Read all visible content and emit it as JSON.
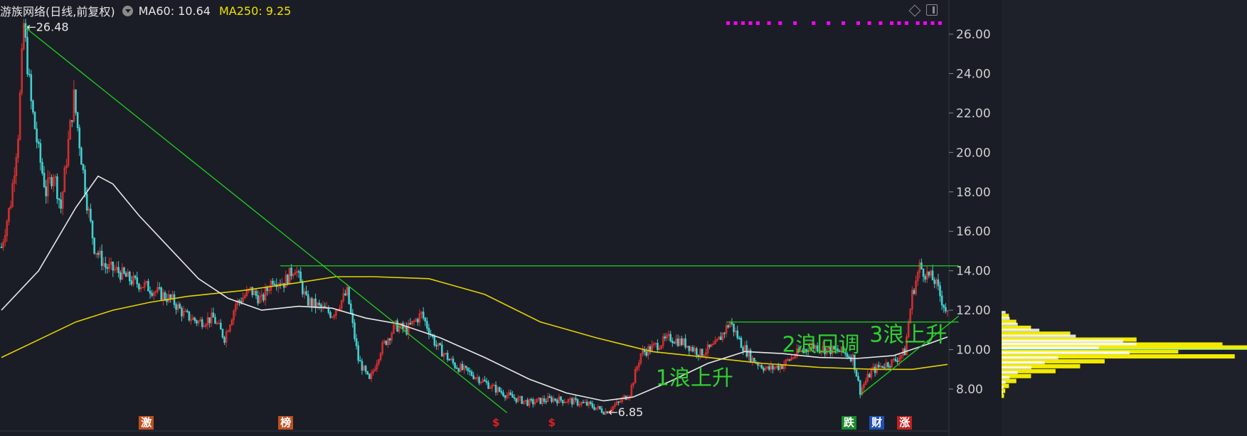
{
  "header": {
    "title": "游族网络(日线,前复权)",
    "ma60_label": "MA60: 10.64",
    "ma250_label": "MA250: 9.25"
  },
  "colors": {
    "background": "#1a1d25",
    "up_candle": "#e03030",
    "down_candle": "#40d0d0",
    "ma60": "#e8e8e8",
    "ma250": "#e6d000",
    "trendline": "#20d020",
    "annotation": "#30d030",
    "volume_profile": "#f2ea00",
    "signal_dots": "#ff00ff"
  },
  "icons": [
    "dropdown-circle-icon",
    "diamond-icon",
    "panel-toggle-icon"
  ],
  "chart_data": {
    "type": "candlestick",
    "ylim": [
      6.5,
      27.2
    ],
    "yticks": [
      "26.00",
      "24.00",
      "22.00",
      "20.00",
      "18.00",
      "16.00",
      "14.00",
      "12.00",
      "10.00",
      "8.00"
    ],
    "grid": false,
    "price_path": [
      {
        "day": 0,
        "close": 15.2
      },
      {
        "day": 5,
        "close": 17.5
      },
      {
        "day": 9,
        "close": 21.0
      },
      {
        "day": 12,
        "close": 26.48
      },
      {
        "day": 16,
        "close": 22.5
      },
      {
        "day": 20,
        "close": 20.0
      },
      {
        "day": 24,
        "close": 18.0
      },
      {
        "day": 28,
        "close": 19.0
      },
      {
        "day": 32,
        "close": 17.2
      },
      {
        "day": 36,
        "close": 20.5
      },
      {
        "day": 39,
        "close": 22.8
      },
      {
        "day": 42,
        "close": 20.5
      },
      {
        "day": 46,
        "close": 17.5
      },
      {
        "day": 50,
        "close": 15.2
      },
      {
        "day": 56,
        "close": 14.2
      },
      {
        "day": 62,
        "close": 14.0
      },
      {
        "day": 70,
        "close": 13.5
      },
      {
        "day": 78,
        "close": 13.2
      },
      {
        "day": 86,
        "close": 12.8
      },
      {
        "day": 92,
        "close": 12.5
      },
      {
        "day": 98,
        "close": 11.8
      },
      {
        "day": 106,
        "close": 11.4
      },
      {
        "day": 114,
        "close": 11.6
      },
      {
        "day": 120,
        "close": 10.6
      },
      {
        "day": 126,
        "close": 12.3
      },
      {
        "day": 134,
        "close": 13.0
      },
      {
        "day": 140,
        "close": 12.5
      },
      {
        "day": 146,
        "close": 13.6
      },
      {
        "day": 152,
        "close": 13.4
      },
      {
        "day": 158,
        "close": 14.2
      },
      {
        "day": 164,
        "close": 12.5
      },
      {
        "day": 170,
        "close": 12.2
      },
      {
        "day": 178,
        "close": 11.8
      },
      {
        "day": 186,
        "close": 12.9
      },
      {
        "day": 192,
        "close": 9.5
      },
      {
        "day": 198,
        "close": 8.4
      },
      {
        "day": 204,
        "close": 10.0
      },
      {
        "day": 212,
        "close": 11.2
      },
      {
        "day": 218,
        "close": 11.0
      },
      {
        "day": 226,
        "close": 11.8
      },
      {
        "day": 234,
        "close": 10.2
      },
      {
        "day": 244,
        "close": 9.2
      },
      {
        "day": 254,
        "close": 8.7
      },
      {
        "day": 264,
        "close": 8.1
      },
      {
        "day": 274,
        "close": 7.6
      },
      {
        "day": 284,
        "close": 7.3
      },
      {
        "day": 296,
        "close": 7.5
      },
      {
        "day": 306,
        "close": 7.4
      },
      {
        "day": 316,
        "close": 7.2
      },
      {
        "day": 325,
        "close": 6.85
      },
      {
        "day": 332,
        "close": 7.3
      },
      {
        "day": 338,
        "close": 7.8
      },
      {
        "day": 344,
        "close": 9.8
      },
      {
        "day": 352,
        "close": 10.2
      },
      {
        "day": 360,
        "close": 10.6
      },
      {
        "day": 368,
        "close": 10.3
      },
      {
        "day": 376,
        "close": 9.8
      },
      {
        "day": 384,
        "close": 10.2
      },
      {
        "day": 392,
        "close": 11.4
      },
      {
        "day": 398,
        "close": 10.3
      },
      {
        "day": 404,
        "close": 9.5
      },
      {
        "day": 412,
        "close": 9.0
      },
      {
        "day": 420,
        "close": 9.2
      },
      {
        "day": 428,
        "close": 9.8
      },
      {
        "day": 436,
        "close": 10.2
      },
      {
        "day": 444,
        "close": 10.0
      },
      {
        "day": 452,
        "close": 9.9
      },
      {
        "day": 458,
        "close": 9.6
      },
      {
        "day": 462,
        "close": 7.9
      },
      {
        "day": 468,
        "close": 8.9
      },
      {
        "day": 474,
        "close": 9.2
      },
      {
        "day": 480,
        "close": 9.4
      },
      {
        "day": 486,
        "close": 9.9
      },
      {
        "day": 490,
        "close": 12.8
      },
      {
        "day": 494,
        "close": 14.2
      },
      {
        "day": 498,
        "close": 13.8
      },
      {
        "day": 502,
        "close": 13.5
      },
      {
        "day": 506,
        "close": 12.5
      },
      {
        "day": 509,
        "close": 11.8
      }
    ],
    "ma60": [
      {
        "day": 0,
        "value": 12.0
      },
      {
        "day": 20,
        "value": 14.0
      },
      {
        "day": 40,
        "value": 17.2
      },
      {
        "day": 52,
        "value": 18.8
      },
      {
        "day": 60,
        "value": 18.4
      },
      {
        "day": 74,
        "value": 16.8
      },
      {
        "day": 90,
        "value": 15.2
      },
      {
        "day": 106,
        "value": 13.6
      },
      {
        "day": 122,
        "value": 12.6
      },
      {
        "day": 140,
        "value": 12.0
      },
      {
        "day": 160,
        "value": 12.2
      },
      {
        "day": 178,
        "value": 12.1
      },
      {
        "day": 196,
        "value": 11.6
      },
      {
        "day": 214,
        "value": 11.3
      },
      {
        "day": 236,
        "value": 10.6
      },
      {
        "day": 260,
        "value": 9.6
      },
      {
        "day": 284,
        "value": 8.5
      },
      {
        "day": 304,
        "value": 7.8
      },
      {
        "day": 324,
        "value": 7.4
      },
      {
        "day": 340,
        "value": 7.6
      },
      {
        "day": 360,
        "value": 8.4
      },
      {
        "day": 380,
        "value": 9.3
      },
      {
        "day": 400,
        "value": 9.9
      },
      {
        "day": 420,
        "value": 9.8
      },
      {
        "day": 440,
        "value": 9.6
      },
      {
        "day": 460,
        "value": 9.55
      },
      {
        "day": 480,
        "value": 9.7
      },
      {
        "day": 496,
        "value": 10.2
      },
      {
        "day": 509,
        "value": 10.64
      }
    ],
    "ma250": [
      {
        "day": 0,
        "value": 9.6
      },
      {
        "day": 20,
        "value": 10.5
      },
      {
        "day": 40,
        "value": 11.4
      },
      {
        "day": 60,
        "value": 12.0
      },
      {
        "day": 80,
        "value": 12.4
      },
      {
        "day": 100,
        "value": 12.7
      },
      {
        "day": 130,
        "value": 13.0
      },
      {
        "day": 160,
        "value": 13.4
      },
      {
        "day": 180,
        "value": 13.7
      },
      {
        "day": 200,
        "value": 13.7
      },
      {
        "day": 230,
        "value": 13.6
      },
      {
        "day": 260,
        "value": 12.8
      },
      {
        "day": 290,
        "value": 11.4
      },
      {
        "day": 320,
        "value": 10.6
      },
      {
        "day": 350,
        "value": 9.9
      },
      {
        "day": 380,
        "value": 9.6
      },
      {
        "day": 410,
        "value": 9.3
      },
      {
        "day": 440,
        "value": 9.1
      },
      {
        "day": 470,
        "value": 9.0
      },
      {
        "day": 490,
        "value": 9.0
      },
      {
        "day": 509,
        "value": 9.25
      }
    ],
    "trendlines": [
      {
        "from": {
          "day": 12,
          "price": 26.4
        },
        "to": {
          "day": 272,
          "price": 6.8
        }
      },
      {
        "from": {
          "day": 150,
          "price": 14.25
        },
        "to": {
          "day": 515,
          "price": 14.25
        }
      },
      {
        "from": {
          "day": 390,
          "price": 11.4
        },
        "to": {
          "day": 515,
          "price": 11.4
        }
      },
      {
        "from": {
          "day": 462,
          "price": 7.7
        },
        "to": {
          "day": 515,
          "price": 11.7
        }
      }
    ],
    "price_labels": [
      {
        "text": "26.48",
        "day": 12,
        "price": 26.48
      },
      {
        "text": "6.85",
        "day": 325,
        "price": 6.85
      }
    ],
    "annotations": [
      {
        "text": "1浪上升",
        "day": 352,
        "price": 8.2
      },
      {
        "text": "2浪回调",
        "day": 420,
        "price": 9.9
      },
      {
        "text": "3浪上升",
        "day": 467,
        "price": 10.4
      }
    ],
    "markers": [
      {
        "text": "激",
        "day": 77,
        "color": "#c0501f"
      },
      {
        "text": "榜",
        "day": 152,
        "color": "#c0501f"
      },
      {
        "text": "$",
        "day": 266,
        "color": "#e02020"
      },
      {
        "text": "$",
        "day": 296,
        "color": "#e02020"
      },
      {
        "text": "跌",
        "day": 455,
        "color": "#1a8a2a"
      },
      {
        "text": "财",
        "day": 470,
        "color": "#2050b0"
      },
      {
        "text": "涨",
        "day": 485,
        "color": "#c02020"
      }
    ],
    "volume_profile": [
      {
        "price": 11.6,
        "width": 0.03
      },
      {
        "price": 11.3,
        "width": 0.06
      },
      {
        "price": 11.0,
        "width": 0.12
      },
      {
        "price": 10.7,
        "width": 0.28
      },
      {
        "price": 10.4,
        "width": 0.55
      },
      {
        "price": 10.15,
        "width": 0.9
      },
      {
        "price": 10.0,
        "width": 1.0
      },
      {
        "price": 9.8,
        "width": 0.72
      },
      {
        "price": 9.55,
        "width": 0.95
      },
      {
        "price": 9.3,
        "width": 0.42
      },
      {
        "price": 9.05,
        "width": 0.32
      },
      {
        "price": 8.8,
        "width": 0.22
      },
      {
        "price": 8.55,
        "width": 0.12
      },
      {
        "price": 8.3,
        "width": 0.06
      },
      {
        "price": 8.05,
        "width": 0.03
      },
      {
        "price": 7.8,
        "width": 0.015
      },
      {
        "price": 7.55,
        "width": 0.01
      }
    ],
    "signal_dots_days": [
      390,
      394,
      398,
      402,
      406,
      412,
      418,
      426,
      436,
      444,
      452,
      460,
      466,
      472,
      478,
      482,
      486,
      492,
      496,
      500,
      504
    ]
  }
}
